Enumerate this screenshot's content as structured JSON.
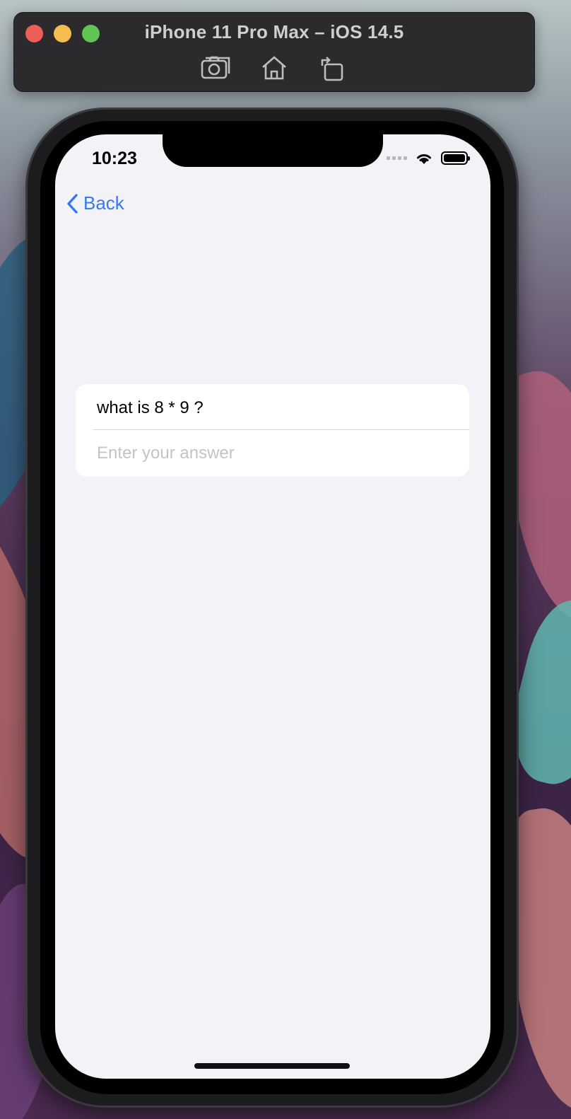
{
  "simulator": {
    "title": "iPhone 11 Pro Max – iOS 14.5",
    "tools": [
      "camera-screenshot-icon",
      "home-icon",
      "rotate-icon"
    ]
  },
  "status_bar": {
    "time": "10:23"
  },
  "nav": {
    "back_label": "Back"
  },
  "quiz": {
    "question": "what is 8 * 9 ?",
    "answer_value": "",
    "answer_placeholder": "Enter your answer"
  },
  "colors": {
    "accent": "#3478f6",
    "screen_background": "#f2f2f7",
    "card_background": "#ffffff",
    "placeholder": "#c4c4c7"
  }
}
